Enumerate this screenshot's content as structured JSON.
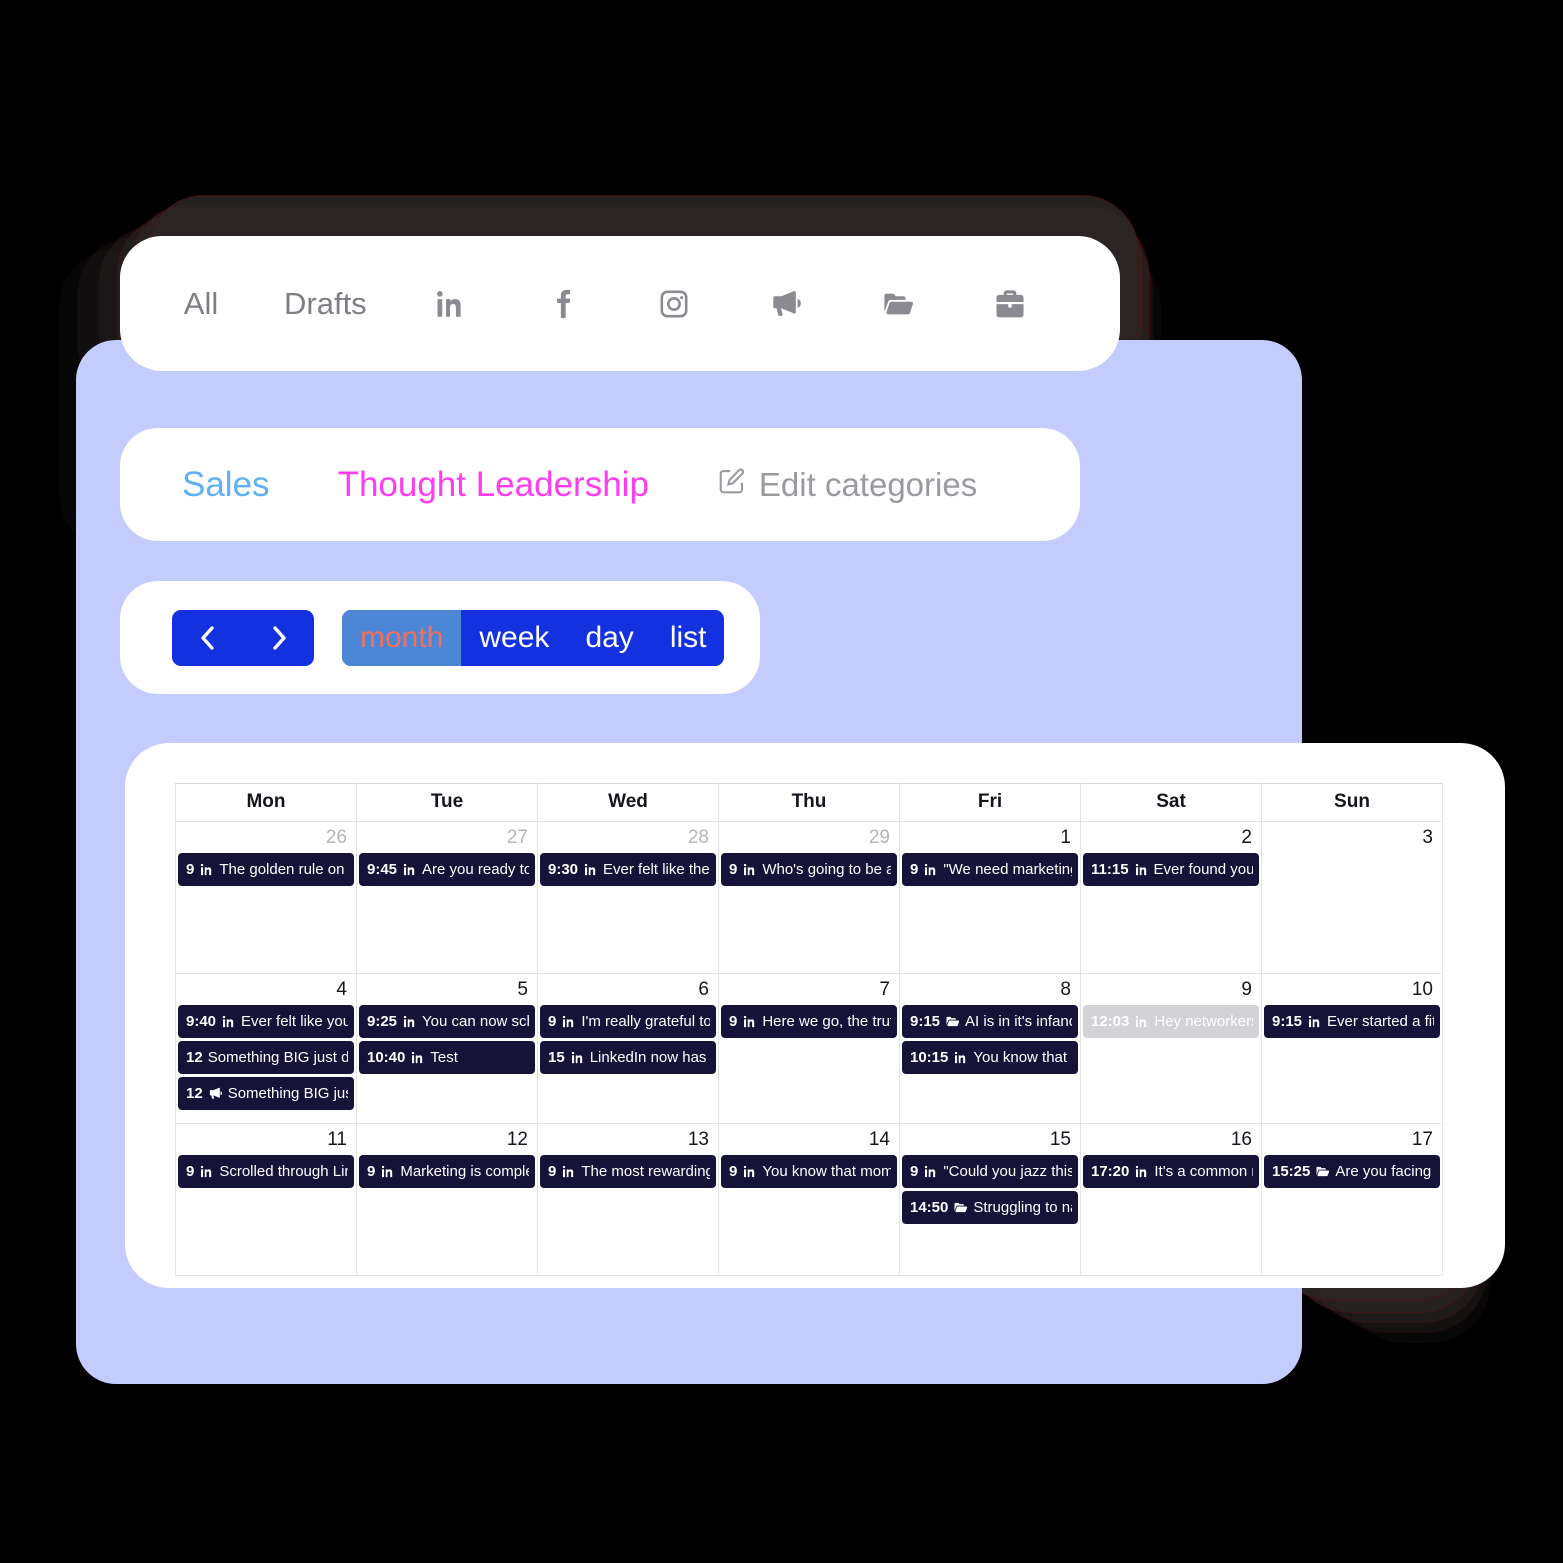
{
  "theme": {
    "canvas_bg": "#000000",
    "panel_bg": "#c3ccfd",
    "card_bg": "#ffffff",
    "accent_blue": "#1431e0",
    "active_tab_bg": "#4e86d6",
    "active_tab_text": "#f0705e",
    "event_bg": "#161338",
    "event_past_bg": "#d2d2d7",
    "sales_color": "#60b0f5",
    "thought_leadership_color": "#ff3df0"
  },
  "filter_bar": {
    "items": [
      {
        "label": "All",
        "icon": null,
        "name": "filter-all"
      },
      {
        "label": "Drafts",
        "icon": null,
        "name": "filter-drafts"
      },
      {
        "label": "",
        "icon": "linkedin-icon",
        "name": "filter-linkedin"
      },
      {
        "label": "",
        "icon": "facebook-icon",
        "name": "filter-facebook"
      },
      {
        "label": "",
        "icon": "instagram-icon",
        "name": "filter-instagram"
      },
      {
        "label": "",
        "icon": "megaphone-icon",
        "name": "filter-campaigns"
      },
      {
        "label": "",
        "icon": "folder-open-icon",
        "name": "filter-folders"
      },
      {
        "label": "",
        "icon": "briefcase-icon",
        "name": "filter-business"
      }
    ]
  },
  "categories": {
    "items": [
      {
        "label": "Sales",
        "color": "#60b0f5"
      },
      {
        "label": "Thought Leadership",
        "color": "#ff3df0"
      }
    ],
    "edit_label": "Edit categories"
  },
  "toolbar": {
    "prev_label": "‹",
    "next_label": "›",
    "views": [
      {
        "label": "month",
        "active": true
      },
      {
        "label": "week",
        "active": false
      },
      {
        "label": "day",
        "active": false
      },
      {
        "label": "list",
        "active": false
      }
    ]
  },
  "calendar": {
    "weekdays": [
      "Mon",
      "Tue",
      "Wed",
      "Thu",
      "Fri",
      "Sat",
      "Sun"
    ],
    "weeks": [
      {
        "days": [
          {
            "num": "26",
            "other_month": true,
            "events": [
              {
                "time": "9",
                "icon": "linkedin-icon",
                "title": "The golden rule on L",
                "past": false
              }
            ]
          },
          {
            "num": "27",
            "other_month": true,
            "events": [
              {
                "time": "9:45",
                "icon": "linkedin-icon",
                "title": "Are you ready to ",
                "past": false
              }
            ]
          },
          {
            "num": "28",
            "other_month": true,
            "events": [
              {
                "time": "9:30",
                "icon": "linkedin-icon",
                "title": "Ever felt like ther",
                "past": false
              }
            ]
          },
          {
            "num": "29",
            "other_month": true,
            "events": [
              {
                "time": "9",
                "icon": "linkedin-icon",
                "title": "Who's going to be at",
                "past": false
              }
            ]
          },
          {
            "num": "1",
            "other_month": false,
            "events": [
              {
                "time": "9",
                "icon": "linkedin-icon",
                "title": "\"We need marketing",
                "past": false
              }
            ]
          },
          {
            "num": "2",
            "other_month": false,
            "events": [
              {
                "time": "11:15",
                "icon": "linkedin-icon",
                "title": "Ever found your",
                "past": false
              }
            ]
          },
          {
            "num": "3",
            "other_month": false,
            "events": []
          }
        ]
      },
      {
        "days": [
          {
            "num": "4",
            "other_month": false,
            "events": [
              {
                "time": "9:40",
                "icon": "linkedin-icon",
                "title": "Ever felt like you'",
                "past": false
              },
              {
                "time": "12",
                "icon": null,
                "title": "Something BIG just dr",
                "past": false
              },
              {
                "time": "12",
                "icon": "megaphone-icon",
                "title": "Something BIG just",
                "past": false
              }
            ]
          },
          {
            "num": "5",
            "other_month": false,
            "events": [
              {
                "time": "9:25",
                "icon": "linkedin-icon",
                "title": "You can now sch",
                "past": false
              },
              {
                "time": "10:40",
                "icon": "linkedin-icon",
                "title": "Test",
                "past": false
              }
            ]
          },
          {
            "num": "6",
            "other_month": false,
            "events": [
              {
                "time": "9",
                "icon": "linkedin-icon",
                "title": "I'm really grateful to",
                "past": false
              },
              {
                "time": "15",
                "icon": "linkedin-icon",
                "title": "LinkedIn now has o",
                "past": false
              }
            ]
          },
          {
            "num": "7",
            "other_month": false,
            "events": [
              {
                "time": "9",
                "icon": "linkedin-icon",
                "title": "Here we go, the truth",
                "past": false
              }
            ]
          },
          {
            "num": "8",
            "other_month": false,
            "events": [
              {
                "time": "9:15",
                "icon": "folder-open-icon",
                "title": "AI is in it's infanc",
                "past": false
              },
              {
                "time": "10:15",
                "icon": "linkedin-icon",
                "title": "You know that n",
                "past": false
              }
            ]
          },
          {
            "num": "9",
            "other_month": false,
            "events": [
              {
                "time": "12:03",
                "icon": "linkedin-icon",
                "title": "Hey networkers",
                "past": true
              }
            ]
          },
          {
            "num": "10",
            "other_month": false,
            "events": [
              {
                "time": "9:15",
                "icon": "linkedin-icon",
                "title": "Ever started a fitn",
                "past": false
              }
            ]
          }
        ]
      },
      {
        "days": [
          {
            "num": "11",
            "other_month": false,
            "events": [
              {
                "time": "9",
                "icon": "linkedin-icon",
                "title": "Scrolled through Lin",
                "past": false
              }
            ]
          },
          {
            "num": "12",
            "other_month": false,
            "events": [
              {
                "time": "9",
                "icon": "linkedin-icon",
                "title": "Marketing is comple",
                "past": false
              }
            ]
          },
          {
            "num": "13",
            "other_month": false,
            "events": [
              {
                "time": "9",
                "icon": "linkedin-icon",
                "title": "The most rewarding",
                "past": false
              }
            ]
          },
          {
            "num": "14",
            "other_month": false,
            "events": [
              {
                "time": "9",
                "icon": "linkedin-icon",
                "title": "You know that mome",
                "past": false
              }
            ]
          },
          {
            "num": "15",
            "other_month": false,
            "events": [
              {
                "time": "9",
                "icon": "linkedin-icon",
                "title": "\"Could you jazz this",
                "past": false
              },
              {
                "time": "14:50",
                "icon": "folder-open-icon",
                "title": "Struggling to na",
                "past": false
              }
            ]
          },
          {
            "num": "16",
            "other_month": false,
            "events": [
              {
                "time": "17:20",
                "icon": "linkedin-icon",
                "title": "It's a common m",
                "past": false
              }
            ]
          },
          {
            "num": "17",
            "other_month": false,
            "events": [
              {
                "time": "15:25",
                "icon": "folder-open-icon",
                "title": "Are you facing t",
                "past": false
              }
            ]
          }
        ]
      }
    ]
  }
}
